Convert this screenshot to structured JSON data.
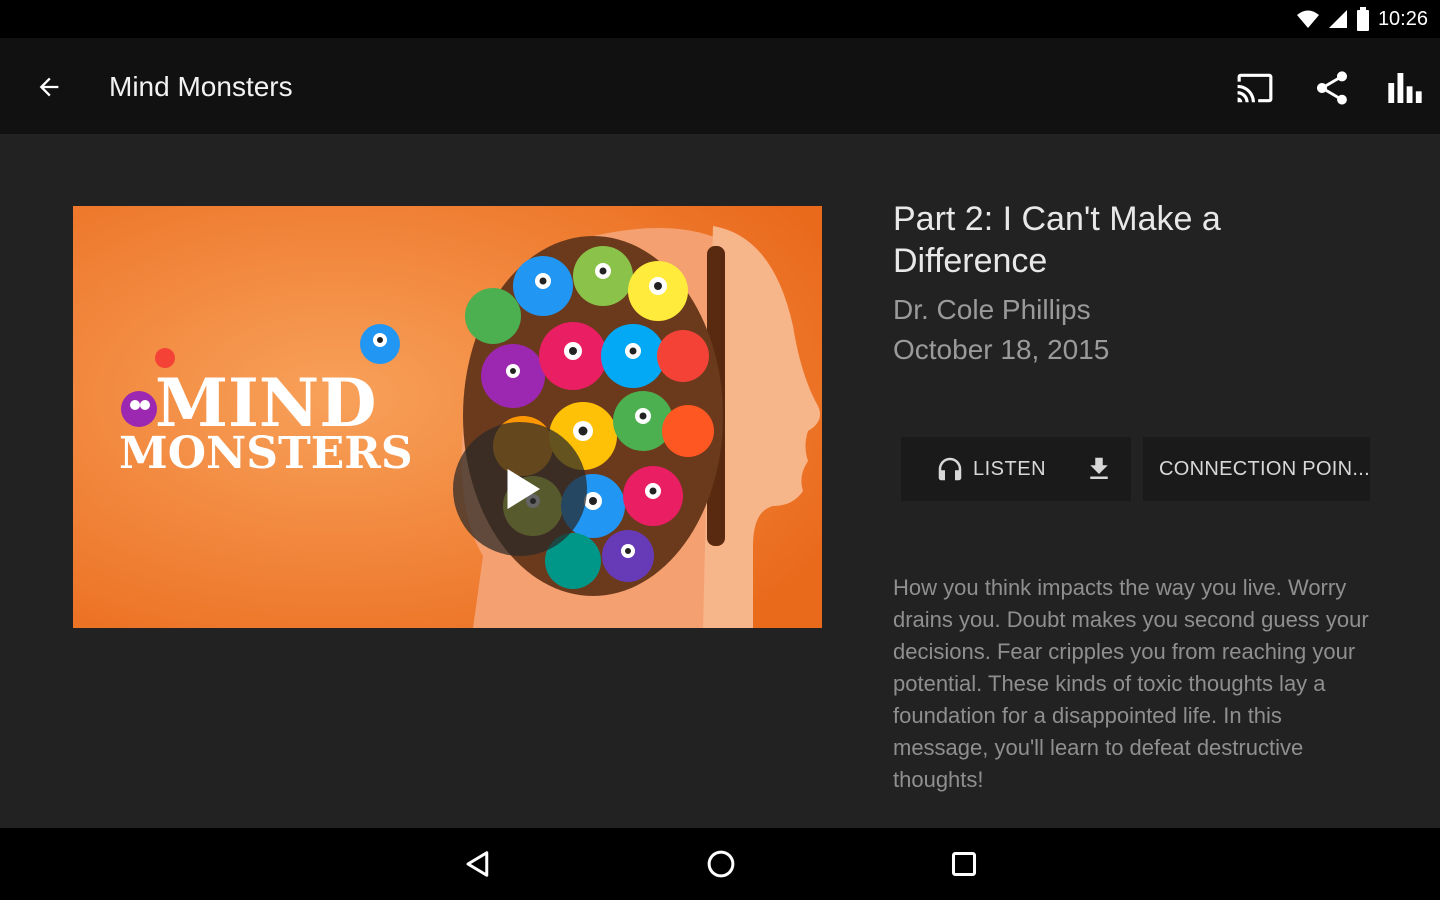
{
  "status_bar": {
    "time": "10:26",
    "icons": [
      "wifi-icon",
      "signal-icon",
      "battery-icon"
    ]
  },
  "app_bar": {
    "title": "Mind Monsters",
    "actions": [
      "cast-icon",
      "share-icon",
      "chart-icon"
    ]
  },
  "media": {
    "artwork_title_line1": "MIND",
    "artwork_title_line2": "MONSTERS"
  },
  "episode": {
    "title": "Part 2: I Can't Make a Difference",
    "speaker": "Dr. Cole Phillips",
    "date": "October 18, 2015",
    "description": "How you think impacts the way you live. Worry drains you. Doubt makes you second guess your decisions. Fear cripples you from reaching your potential. These kinds of toxic thoughts lay a foundation for a disappointed life. In this message, you'll learn to defeat destructive thoughts!"
  },
  "buttons": {
    "listen_label": "LISTEN",
    "connection_label": "CONNECTION POIN..."
  },
  "colors": {
    "background": "#222222",
    "app_bar": "#111111",
    "artwork_orange": "#f07b2a",
    "button_bg": "#1a1a1a"
  }
}
